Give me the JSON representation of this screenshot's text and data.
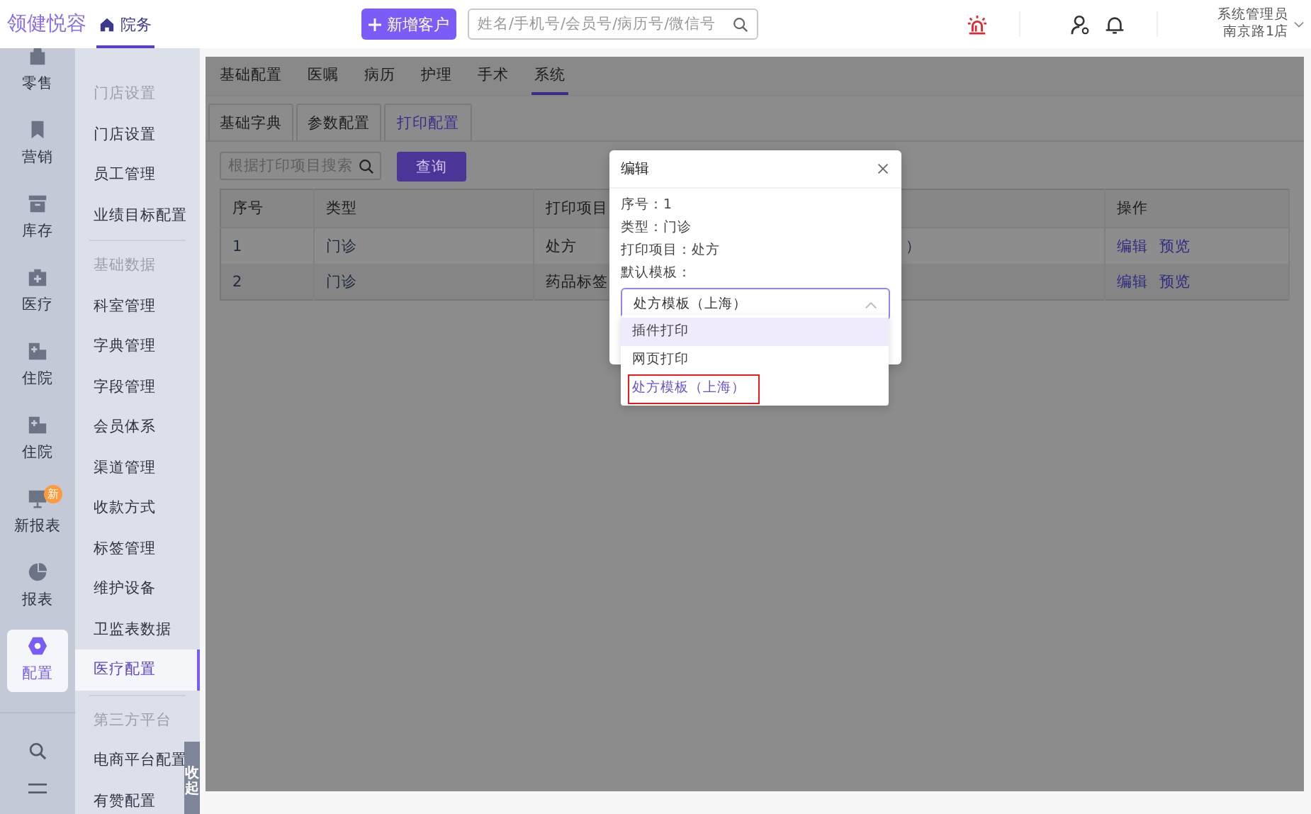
{
  "header": {
    "logo": "领健悦容",
    "nav": [
      {
        "label": "院务",
        "selected": true
      }
    ],
    "add_button": "新增客户",
    "search": {
      "placeholder": "姓名/手机号/会员号/病历号/微信号"
    },
    "user": {
      "name": "系统管理员",
      "store": "南京路1店"
    }
  },
  "rail": [
    {
      "label": "零售",
      "selected": false
    },
    {
      "label": "营销",
      "selected": false
    },
    {
      "label": "库存",
      "selected": false
    },
    {
      "label": "医疗",
      "selected": false
    },
    {
      "label": "住院",
      "selected": false
    },
    {
      "label": "住院",
      "selected": false
    },
    {
      "label": "新报表",
      "selected": false,
      "badge": "新"
    },
    {
      "label": "报表",
      "selected": false
    },
    {
      "label": "配置",
      "selected": true
    }
  ],
  "submenu": [
    {
      "kind": "heading",
      "label": "门店设置"
    },
    {
      "kind": "item",
      "label": "门店设置",
      "selected": false
    },
    {
      "kind": "item",
      "label": "员工管理",
      "selected": false
    },
    {
      "kind": "item",
      "label": "业绩目标配置",
      "selected": false
    },
    {
      "kind": "divider"
    },
    {
      "kind": "heading",
      "label": "基础数据"
    },
    {
      "kind": "item",
      "label": "科室管理",
      "selected": false
    },
    {
      "kind": "item",
      "label": "字典管理",
      "selected": false
    },
    {
      "kind": "item",
      "label": "字段管理",
      "selected": false
    },
    {
      "kind": "item",
      "label": "会员体系",
      "selected": false
    },
    {
      "kind": "item",
      "label": "渠道管理",
      "selected": false
    },
    {
      "kind": "item",
      "label": "收款方式",
      "selected": false
    },
    {
      "kind": "item",
      "label": "标签管理",
      "selected": false
    },
    {
      "kind": "item",
      "label": "维护设备",
      "selected": false
    },
    {
      "kind": "item",
      "label": "卫监表数据",
      "selected": false
    },
    {
      "kind": "item",
      "label": "医疗配置",
      "selected": true
    },
    {
      "kind": "divider"
    },
    {
      "kind": "heading",
      "label": "第三方平台"
    },
    {
      "kind": "item",
      "label": "电商平台配置",
      "selected": false
    },
    {
      "kind": "item",
      "label": "有赞配置",
      "selected": false
    }
  ],
  "collapse_tab": "收起",
  "tabs": [
    {
      "label": "基础配置",
      "selected": false
    },
    {
      "label": "医嘱",
      "selected": false
    },
    {
      "label": "病历",
      "selected": false
    },
    {
      "label": "护理",
      "selected": false
    },
    {
      "label": "手术",
      "selected": false
    },
    {
      "label": "系统",
      "selected": true
    }
  ],
  "subtabs": [
    {
      "label": "基础字典",
      "selected": false
    },
    {
      "label": "参数配置",
      "selected": false
    },
    {
      "label": "打印配置",
      "selected": true
    }
  ],
  "search": {
    "placeholder": "根据打印项目搜索"
  },
  "query_button": "查询",
  "table": {
    "columns": [
      "序号",
      "类型",
      "打印项目",
      null,
      "操作"
    ],
    "rows": [
      {
        "cells": [
          "1",
          "门诊",
          "处方",
          "）"
        ],
        "actions": [
          "编辑",
          "预览"
        ]
      },
      {
        "cells": [
          "2",
          "门诊",
          "药品标签",
          null
        ],
        "actions": [
          "编辑",
          "预览"
        ]
      }
    ]
  },
  "modal": {
    "title": "编辑",
    "lines": [
      "序号：1",
      "类型：门诊",
      "打印项目：处方"
    ],
    "template_label": "默认模板：",
    "select": {
      "value": "处方模板（上海）",
      "expanded": true
    },
    "options": [
      {
        "label": "插件打印",
        "hovered": true,
        "selected": false,
        "highlighted": false
      },
      {
        "label": "网页打印",
        "hovered": false,
        "selected": false,
        "highlighted": false
      },
      {
        "label": "处方模板（上海）",
        "hovered": false,
        "selected": true,
        "highlighted": true
      }
    ]
  }
}
